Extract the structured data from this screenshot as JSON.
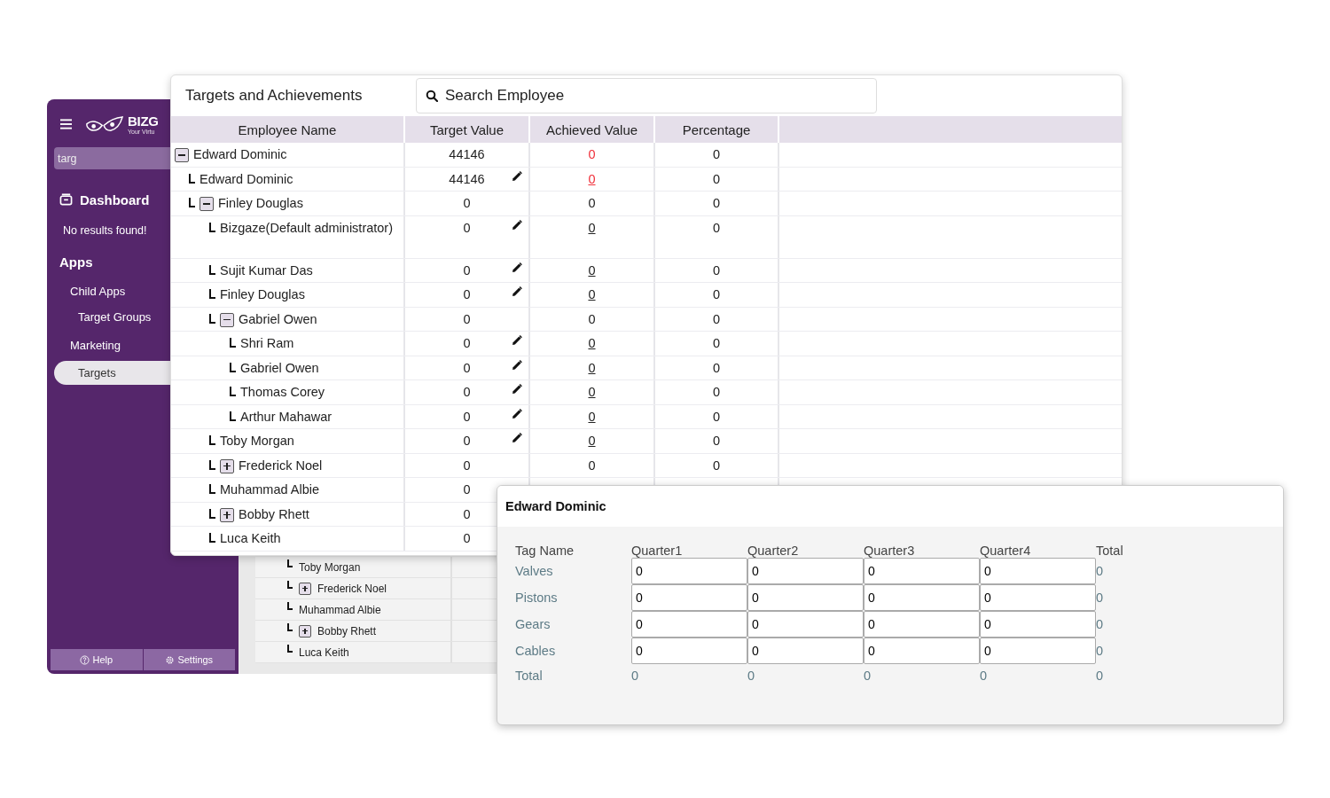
{
  "back_window": {
    "sidebar": {
      "logo": {
        "name": "BIZG",
        "tagline": "Your Virtu"
      },
      "search": {
        "value": "targ"
      },
      "items": [
        {
          "label": "Dashboard",
          "kind": "main",
          "selected": false
        },
        {
          "label": "No results found!",
          "kind": "note",
          "selected": false
        },
        {
          "label": "Apps",
          "kind": "heading",
          "selected": false
        },
        {
          "label": "Child Apps",
          "kind": "sub",
          "selected": false
        },
        {
          "label": "Target Groups",
          "kind": "subsub",
          "selected": false
        },
        {
          "label": "Marketing",
          "kind": "sub",
          "selected": false
        },
        {
          "label": "Targets",
          "kind": "subsub",
          "selected": true
        }
      ],
      "footer": [
        {
          "label": "Help",
          "kind": "help"
        },
        {
          "label": "Settings",
          "kind": "settings"
        }
      ]
    },
    "table_rows": [
      {
        "name": "Toby Morgan"
      },
      {
        "name": "Frederick Noel",
        "expanded": false
      },
      {
        "name": "Muhammad Albie"
      },
      {
        "name": "Bobby Rhett",
        "expanded": false
      },
      {
        "name": "Luca Keith"
      }
    ]
  },
  "main_card": {
    "title": "Targets and Achievements",
    "search": {
      "placeholder": "Search Employee"
    },
    "table": {
      "columns": [
        "Employee Name",
        "Target Value",
        "Achieved Value",
        "Percentage"
      ],
      "rows": [
        {
          "name": "Edward Dominic",
          "expanded": true,
          "target": "44146",
          "achieved": "0",
          "percentage": "0",
          "editable": false,
          "highlight": true,
          "children": [
            {
              "name": "Edward Dominic",
              "target": "44146",
              "achieved": "0",
              "percentage": "0",
              "editable": true,
              "highlight": true
            },
            {
              "name": "Finley Douglas",
              "expanded": true,
              "target": "0",
              "achieved": "0",
              "percentage": "0",
              "editable": false,
              "highlight": false,
              "children": [
                {
                  "name": "Bizgaze(Default administrator)",
                  "target": "0",
                  "achieved": "0",
                  "percentage": "0",
                  "editable": true,
                  "highlight": false
                },
                {
                  "name": "Sujit Kumar Das",
                  "target": "0",
                  "achieved": "0",
                  "percentage": "0",
                  "editable": true,
                  "highlight": false
                },
                {
                  "name": "Finley Douglas",
                  "target": "0",
                  "achieved": "0",
                  "percentage": "0",
                  "editable": true,
                  "highlight": false
                },
                {
                  "name": "Gabriel Owen",
                  "expanded": true,
                  "target": "0",
                  "achieved": "0",
                  "percentage": "0",
                  "editable": false,
                  "highlight": false,
                  "children": [
                    {
                      "name": "Shri Ram",
                      "target": "0",
                      "achieved": "0",
                      "percentage": "0",
                      "editable": true,
                      "highlight": false
                    },
                    {
                      "name": "Gabriel Owen",
                      "target": "0",
                      "achieved": "0",
                      "percentage": "0",
                      "editable": true,
                      "highlight": false
                    },
                    {
                      "name": "Thomas Corey",
                      "target": "0",
                      "achieved": "0",
                      "percentage": "0",
                      "editable": true,
                      "highlight": false
                    },
                    {
                      "name": "Arthur Mahawar",
                      "target": "0",
                      "achieved": "0",
                      "percentage": "0",
                      "editable": true,
                      "highlight": false
                    }
                  ]
                },
                {
                  "name": "Toby Morgan",
                  "target": "0",
                  "achieved": "0",
                  "percentage": "0",
                  "editable": true,
                  "highlight": false
                },
                {
                  "name": "Frederick Noel",
                  "expanded": false,
                  "target": "0",
                  "achieved": "0",
                  "percentage": "0",
                  "editable": false,
                  "highlight": false
                },
                {
                  "name": "Muhammad Albie",
                  "target": "0"
                },
                {
                  "name": "Bobby Rhett",
                  "expanded": false,
                  "target": "0"
                },
                {
                  "name": "Luca Keith",
                  "target": "0"
                }
              ]
            }
          ]
        }
      ]
    }
  },
  "modal": {
    "title": "Edward Dominic",
    "columns": [
      "Tag Name",
      "Quarter1",
      "Quarter2",
      "Quarter3",
      "Quarter4",
      "Total"
    ],
    "rows": [
      {
        "tag": "Valves",
        "values": [
          "0",
          "0",
          "0",
          "0"
        ],
        "total": "0"
      },
      {
        "tag": "Pistons",
        "values": [
          "0",
          "0",
          "0",
          "0"
        ],
        "total": "0"
      },
      {
        "tag": "Gears",
        "values": [
          "0",
          "0",
          "0",
          "0"
        ],
        "total": "0"
      },
      {
        "tag": "Cables",
        "values": [
          "0",
          "0",
          "0",
          "0"
        ],
        "total": "0"
      }
    ],
    "totals": {
      "label": "Total",
      "values": [
        "0",
        "0",
        "0",
        "0",
        "0"
      ]
    }
  }
}
